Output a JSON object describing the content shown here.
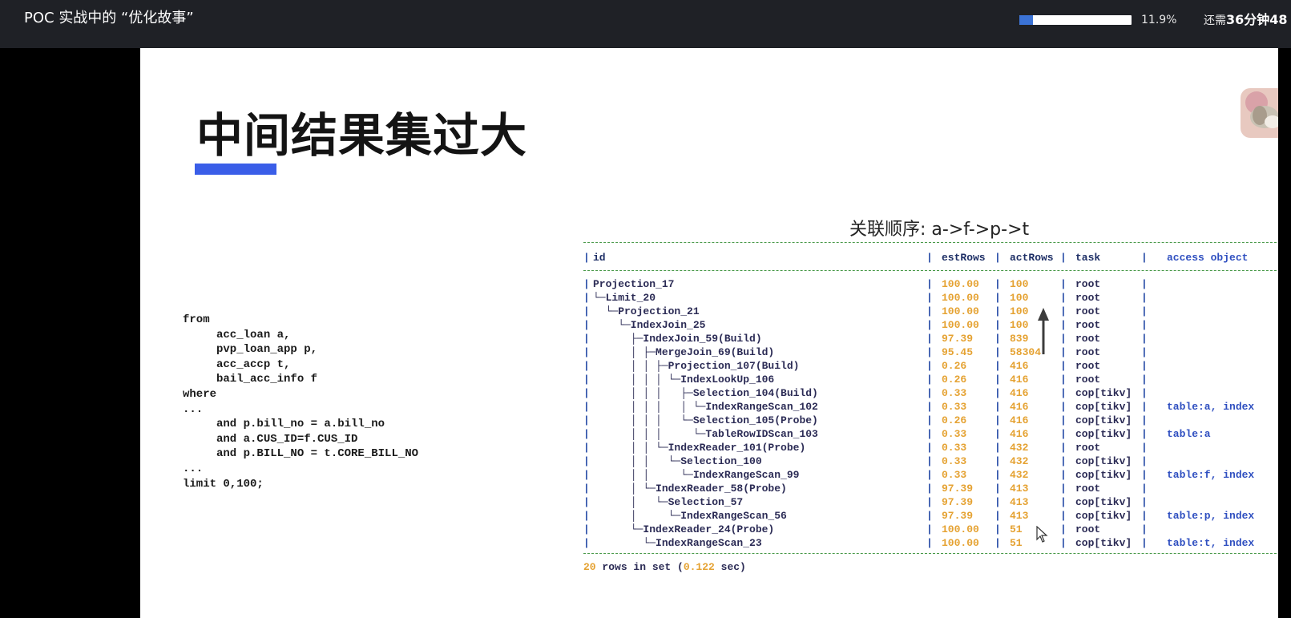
{
  "topbar": {
    "title": "POC 实战中的 “优化故事”",
    "progress_pct": 11.9,
    "progress_label": "11.9%",
    "remaining_prefix": "还需",
    "remaining_time": "36分钟48"
  },
  "slide": {
    "heading": "中间结果集过大",
    "join_order": "关联顺序:   a->f->p->t",
    "sql_lines": [
      "from",
      "     acc_loan a,",
      "     pvp_loan_app p,",
      "     acc_accp t,",
      "     bail_acc_info f",
      "where",
      "...",
      "     and p.bill_no = a.bill_no",
      "     and a.CUS_ID=f.CUS_ID",
      "     and p.BILL_NO = t.CORE_BILL_NO",
      "...",
      "limit 0,100;"
    ],
    "plan": {
      "headers": [
        "id",
        "estRows",
        "actRows",
        "task",
        "access object"
      ],
      "rows": [
        [
          "Projection_17",
          "100.00",
          "100",
          "root",
          ""
        ],
        [
          "└─Limit_20",
          "100.00",
          "100",
          "root",
          ""
        ],
        [
          "  └─Projection_21",
          "100.00",
          "100",
          "root",
          ""
        ],
        [
          "    └─IndexJoin_25",
          "100.00",
          "100",
          "root",
          ""
        ],
        [
          "      ├─IndexJoin_59(Build)",
          "97.39",
          "839",
          "root",
          ""
        ],
        [
          "      │ ├─MergeJoin_69(Build)",
          "95.45",
          "58304",
          "root",
          ""
        ],
        [
          "      │ │ ├─Projection_107(Build)",
          "0.26",
          "416",
          "root",
          ""
        ],
        [
          "      │ │ │ └─IndexLookUp_106",
          "0.26",
          "416",
          "root",
          ""
        ],
        [
          "      │ │ │   ├─Selection_104(Build)",
          "0.33",
          "416",
          "cop[tikv]",
          ""
        ],
        [
          "      │ │ │   │ └─IndexRangeScan_102",
          "0.33",
          "416",
          "cop[tikv]",
          "table:a, index"
        ],
        [
          "      │ │ │   └─Selection_105(Probe)",
          "0.26",
          "416",
          "cop[tikv]",
          ""
        ],
        [
          "      │ │ │     └─TableRowIDScan_103",
          "0.33",
          "416",
          "cop[tikv]",
          "table:a"
        ],
        [
          "      │ │ └─IndexReader_101(Probe)",
          "0.33",
          "432",
          "root",
          ""
        ],
        [
          "      │ │   └─Selection_100",
          "0.33",
          "432",
          "cop[tikv]",
          ""
        ],
        [
          "      │ │     └─IndexRangeScan_99",
          "0.33",
          "432",
          "cop[tikv]",
          "table:f, index"
        ],
        [
          "      │ └─IndexReader_58(Probe)",
          "97.39",
          "413",
          "root",
          ""
        ],
        [
          "      │   └─Selection_57",
          "97.39",
          "413",
          "cop[tikv]",
          ""
        ],
        [
          "      │     └─IndexRangeScan_56",
          "97.39",
          "413",
          "cop[tikv]",
          "table:p, index"
        ],
        [
          "      └─IndexReader_24(Probe)",
          "100.00",
          "51",
          "root",
          ""
        ],
        [
          "        └─IndexRangeScan_23",
          "100.00",
          "51",
          "cop[tikv]",
          "table:t, index"
        ]
      ]
    },
    "summary": {
      "count": "20",
      "mid": " rows in set (",
      "time": "0.122",
      "end": " sec)"
    }
  },
  "colors": {
    "accent_bar": "#3a5ee8",
    "progress_fill": "#3b73d6",
    "orange_values": "#e5a232",
    "dashed_border": "#4a9a4a"
  },
  "icons": [
    "up-arrow-icon",
    "mouse-cursor-icon",
    "presenter-avatar"
  ]
}
